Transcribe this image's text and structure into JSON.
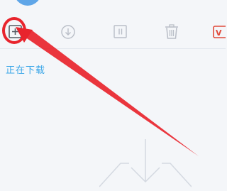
{
  "toolbar": {
    "buttons": [
      {
        "name": "new-download-button",
        "icon": "plus-square-icon"
      },
      {
        "name": "start-button",
        "icon": "download-circle-icon"
      },
      {
        "name": "pause-button",
        "icon": "pause-square-icon"
      },
      {
        "name": "delete-button",
        "icon": "trash-icon"
      },
      {
        "name": "vip-button",
        "icon": "vip-icon"
      }
    ]
  },
  "status": {
    "label": "正在下载"
  },
  "vip_icon_text": "V",
  "colors": {
    "accent": "#3aa6e8",
    "annotation_red": "#e8242d",
    "icon_gray": "#b9bec7",
    "vip_red": "#e04a3a"
  }
}
